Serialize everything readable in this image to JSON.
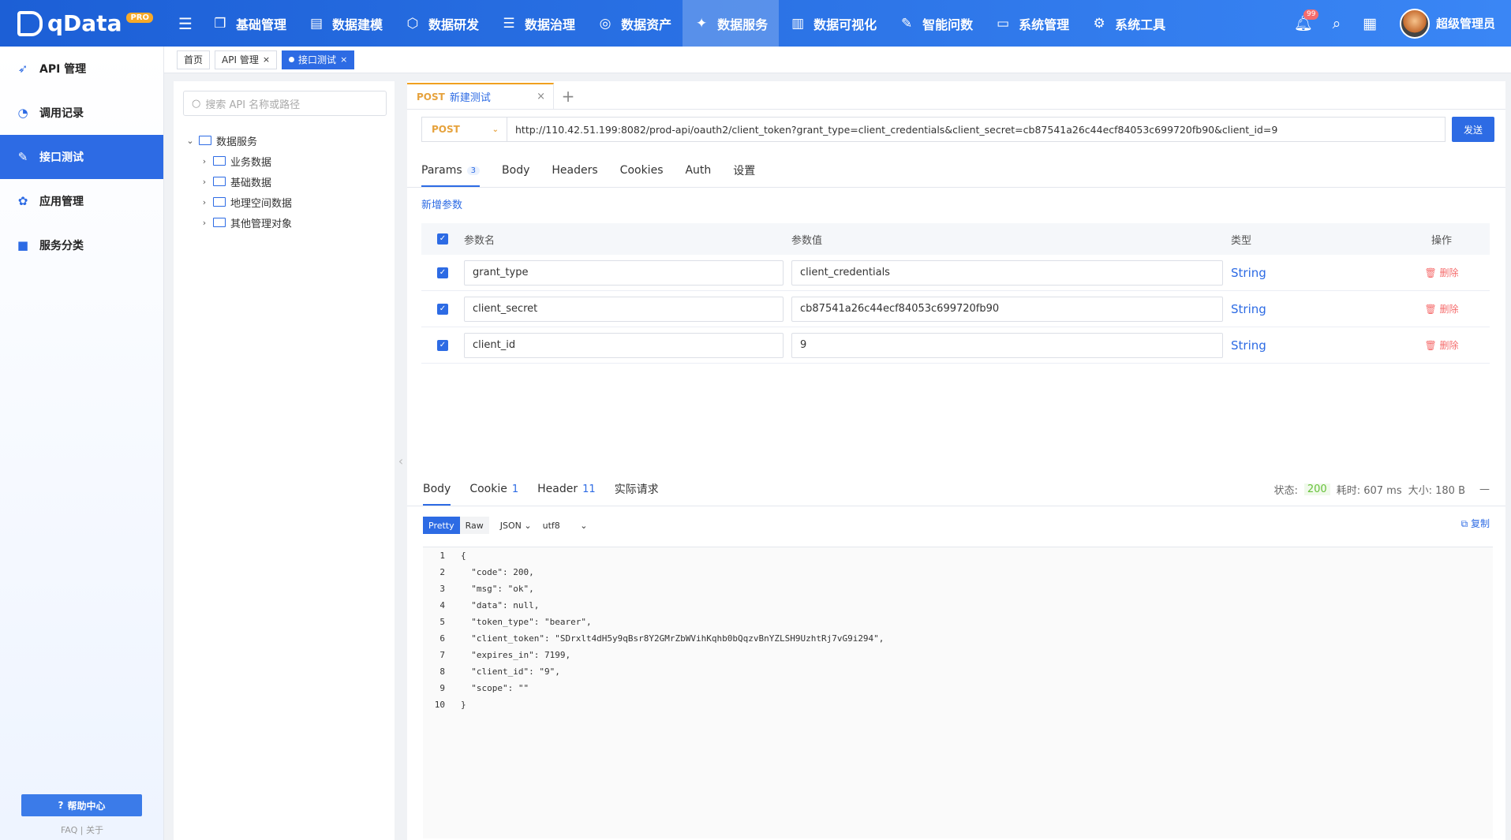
{
  "app": {
    "name": "qData",
    "badge": "PRO"
  },
  "nav": [
    {
      "label": "基础管理",
      "icon": "cube-icon"
    },
    {
      "label": "数据建模",
      "icon": "book-icon"
    },
    {
      "label": "数据研发",
      "icon": "box-icon"
    },
    {
      "label": "数据治理",
      "icon": "database-icon"
    },
    {
      "label": "数据资产",
      "icon": "target-icon"
    },
    {
      "label": "数据服务",
      "icon": "service-icon",
      "active": true
    },
    {
      "label": "数据可视化",
      "icon": "chart-icon"
    },
    {
      "label": "智能问数",
      "icon": "ai-icon"
    },
    {
      "label": "系统管理",
      "icon": "monitor-icon"
    },
    {
      "label": "系统工具",
      "icon": "gear-icon"
    }
  ],
  "user": {
    "name": "超级管理员",
    "notifications": "99"
  },
  "sidebar": {
    "items": [
      {
        "label": "API 管理"
      },
      {
        "label": "调用记录"
      },
      {
        "label": "接口测试",
        "active": true
      },
      {
        "label": "应用管理"
      },
      {
        "label": "服务分类"
      }
    ],
    "help": "帮助中心",
    "footer": "FAQ  |  关于"
  },
  "tags": [
    {
      "label": "首页"
    },
    {
      "label": "API 管理"
    },
    {
      "label": "接口测试",
      "active": true
    }
  ],
  "tree": {
    "search_placeholder": "搜索 API 名称或路径",
    "root": "数据服务",
    "children": [
      "业务数据",
      "基础数据",
      "地理空间数据",
      "其他管理对象"
    ]
  },
  "request": {
    "tab_method": "POST",
    "tab_name": "新建测试",
    "method": "POST",
    "url": "http://110.42.51.199:8082/prod-api/oauth2/client_token?grant_type=client_credentials&client_secret=cb87541a26c44ecf84053c699720fb90&client_id=9",
    "send": "发送",
    "subtabs": [
      "Params",
      "Body",
      "Headers",
      "Cookies",
      "Auth",
      "设置"
    ],
    "params_count": "3",
    "add_param": "新增参数",
    "columns": {
      "name": "参数名",
      "value": "参数值",
      "type": "类型",
      "op": "操作"
    },
    "params": [
      {
        "name": "grant_type",
        "value": "client_credentials",
        "type": "String",
        "op": "删除"
      },
      {
        "name": "client_secret",
        "value": "cb87541a26c44ecf84053c699720fb90",
        "type": "String",
        "op": "删除"
      },
      {
        "name": "client_id",
        "value": "9",
        "type": "String",
        "op": "删除"
      }
    ]
  },
  "response": {
    "tabs": [
      {
        "label": "Body",
        "count": ""
      },
      {
        "label": "Cookie",
        "count": "1"
      },
      {
        "label": "Header",
        "count": "11"
      },
      {
        "label": "实际请求",
        "count": ""
      }
    ],
    "status_label": "状态:",
    "status": "200",
    "time": "耗时: 607 ms",
    "size": "大小: 180 B",
    "formats": [
      "Pretty",
      "Raw"
    ],
    "lang": "JSON",
    "encoding": "utf8",
    "copy": "复制",
    "lines": [
      "{",
      "  \"code\": 200,",
      "  \"msg\": \"ok\",",
      "  \"data\": null,",
      "  \"token_type\": \"bearer\",",
      "  \"client_token\": \"SDrxlt4dH5y9qBsr8Y2GMrZbWVihKqhb0bQqzvBnYZLSH9UzhtRj7vG9i294\",",
      "  \"expires_in\": 7199,",
      "  \"client_id\": \"9\",",
      "  \"scope\": \"\"",
      "}"
    ]
  },
  "colors": {
    "primary": "#2d6be4",
    "header": "#1c5fd6",
    "method": "#e6a23c",
    "danger": "#f56c6c",
    "success": "#67c23a"
  }
}
